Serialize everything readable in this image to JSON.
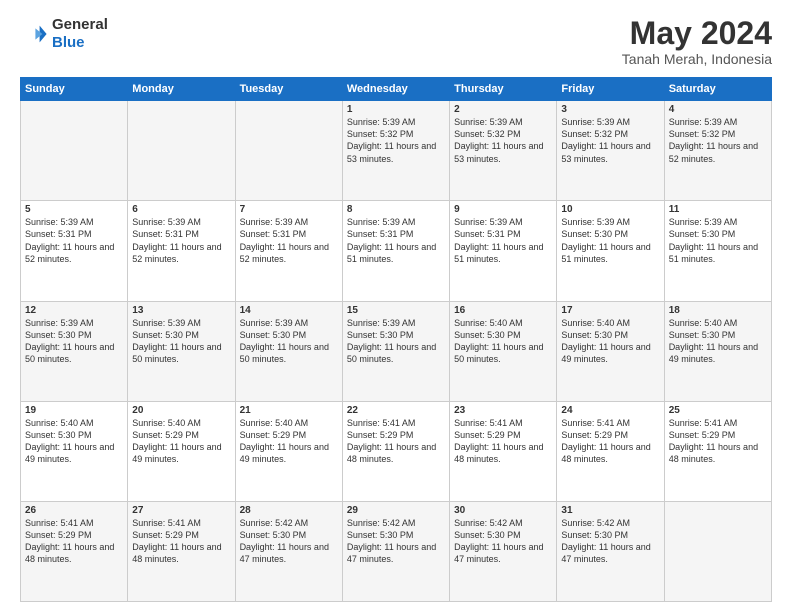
{
  "header": {
    "logo_line1": "General",
    "logo_line2": "Blue",
    "title": "May 2024",
    "subtitle": "Tanah Merah, Indonesia"
  },
  "weekdays": [
    "Sunday",
    "Monday",
    "Tuesday",
    "Wednesday",
    "Thursday",
    "Friday",
    "Saturday"
  ],
  "weeks": [
    [
      {
        "day": "",
        "info": ""
      },
      {
        "day": "",
        "info": ""
      },
      {
        "day": "",
        "info": ""
      },
      {
        "day": "1",
        "info": "Sunrise: 5:39 AM\nSunset: 5:32 PM\nDaylight: 11 hours and 53 minutes."
      },
      {
        "day": "2",
        "info": "Sunrise: 5:39 AM\nSunset: 5:32 PM\nDaylight: 11 hours and 53 minutes."
      },
      {
        "day": "3",
        "info": "Sunrise: 5:39 AM\nSunset: 5:32 PM\nDaylight: 11 hours and 53 minutes."
      },
      {
        "day": "4",
        "info": "Sunrise: 5:39 AM\nSunset: 5:32 PM\nDaylight: 11 hours and 52 minutes."
      }
    ],
    [
      {
        "day": "5",
        "info": "Sunrise: 5:39 AM\nSunset: 5:31 PM\nDaylight: 11 hours and 52 minutes."
      },
      {
        "day": "6",
        "info": "Sunrise: 5:39 AM\nSunset: 5:31 PM\nDaylight: 11 hours and 52 minutes."
      },
      {
        "day": "7",
        "info": "Sunrise: 5:39 AM\nSunset: 5:31 PM\nDaylight: 11 hours and 52 minutes."
      },
      {
        "day": "8",
        "info": "Sunrise: 5:39 AM\nSunset: 5:31 PM\nDaylight: 11 hours and 51 minutes."
      },
      {
        "day": "9",
        "info": "Sunrise: 5:39 AM\nSunset: 5:31 PM\nDaylight: 11 hours and 51 minutes."
      },
      {
        "day": "10",
        "info": "Sunrise: 5:39 AM\nSunset: 5:30 PM\nDaylight: 11 hours and 51 minutes."
      },
      {
        "day": "11",
        "info": "Sunrise: 5:39 AM\nSunset: 5:30 PM\nDaylight: 11 hours and 51 minutes."
      }
    ],
    [
      {
        "day": "12",
        "info": "Sunrise: 5:39 AM\nSunset: 5:30 PM\nDaylight: 11 hours and 50 minutes."
      },
      {
        "day": "13",
        "info": "Sunrise: 5:39 AM\nSunset: 5:30 PM\nDaylight: 11 hours and 50 minutes."
      },
      {
        "day": "14",
        "info": "Sunrise: 5:39 AM\nSunset: 5:30 PM\nDaylight: 11 hours and 50 minutes."
      },
      {
        "day": "15",
        "info": "Sunrise: 5:39 AM\nSunset: 5:30 PM\nDaylight: 11 hours and 50 minutes."
      },
      {
        "day": "16",
        "info": "Sunrise: 5:40 AM\nSunset: 5:30 PM\nDaylight: 11 hours and 50 minutes."
      },
      {
        "day": "17",
        "info": "Sunrise: 5:40 AM\nSunset: 5:30 PM\nDaylight: 11 hours and 49 minutes."
      },
      {
        "day": "18",
        "info": "Sunrise: 5:40 AM\nSunset: 5:30 PM\nDaylight: 11 hours and 49 minutes."
      }
    ],
    [
      {
        "day": "19",
        "info": "Sunrise: 5:40 AM\nSunset: 5:30 PM\nDaylight: 11 hours and 49 minutes."
      },
      {
        "day": "20",
        "info": "Sunrise: 5:40 AM\nSunset: 5:29 PM\nDaylight: 11 hours and 49 minutes."
      },
      {
        "day": "21",
        "info": "Sunrise: 5:40 AM\nSunset: 5:29 PM\nDaylight: 11 hours and 49 minutes."
      },
      {
        "day": "22",
        "info": "Sunrise: 5:41 AM\nSunset: 5:29 PM\nDaylight: 11 hours and 48 minutes."
      },
      {
        "day": "23",
        "info": "Sunrise: 5:41 AM\nSunset: 5:29 PM\nDaylight: 11 hours and 48 minutes."
      },
      {
        "day": "24",
        "info": "Sunrise: 5:41 AM\nSunset: 5:29 PM\nDaylight: 11 hours and 48 minutes."
      },
      {
        "day": "25",
        "info": "Sunrise: 5:41 AM\nSunset: 5:29 PM\nDaylight: 11 hours and 48 minutes."
      }
    ],
    [
      {
        "day": "26",
        "info": "Sunrise: 5:41 AM\nSunset: 5:29 PM\nDaylight: 11 hours and 48 minutes."
      },
      {
        "day": "27",
        "info": "Sunrise: 5:41 AM\nSunset: 5:29 PM\nDaylight: 11 hours and 48 minutes."
      },
      {
        "day": "28",
        "info": "Sunrise: 5:42 AM\nSunset: 5:30 PM\nDaylight: 11 hours and 47 minutes."
      },
      {
        "day": "29",
        "info": "Sunrise: 5:42 AM\nSunset: 5:30 PM\nDaylight: 11 hours and 47 minutes."
      },
      {
        "day": "30",
        "info": "Sunrise: 5:42 AM\nSunset: 5:30 PM\nDaylight: 11 hours and 47 minutes."
      },
      {
        "day": "31",
        "info": "Sunrise: 5:42 AM\nSunset: 5:30 PM\nDaylight: 11 hours and 47 minutes."
      },
      {
        "day": "",
        "info": ""
      }
    ]
  ]
}
